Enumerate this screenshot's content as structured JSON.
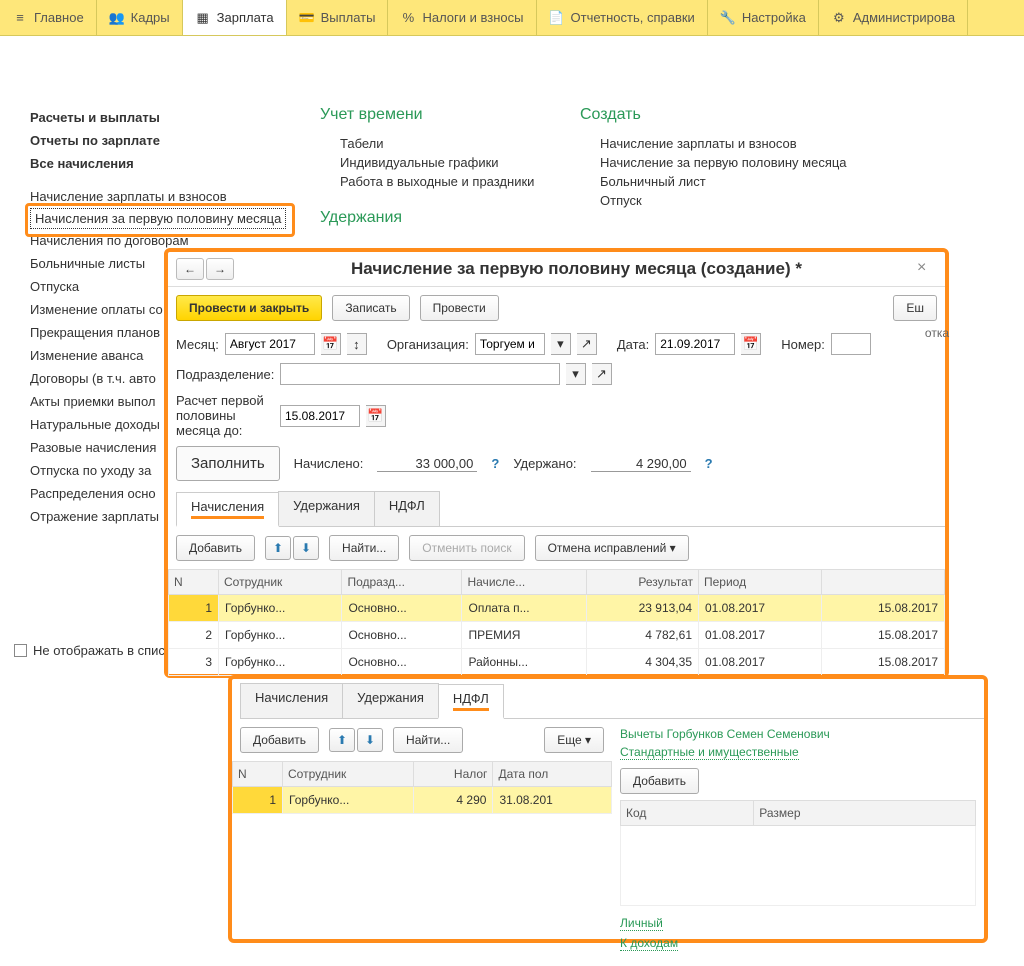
{
  "topnav": {
    "items": [
      {
        "label": "Главное"
      },
      {
        "label": "Кадры"
      },
      {
        "label": "Зарплата"
      },
      {
        "label": "Выплаты"
      },
      {
        "label": "Налоги и взносы"
      },
      {
        "label": "Отчетность, справки"
      },
      {
        "label": "Настройка"
      },
      {
        "label": "Администрирова"
      }
    ]
  },
  "nav": {
    "left_bold": [
      "Расчеты и выплаты",
      "Отчеты по зарплате",
      "Все начисления"
    ],
    "left_items": [
      "Начисление зарплаты и взносов",
      "Начисления за первую половину месяца",
      "Начисления по договорам",
      "Больничные листы",
      "Отпуска",
      "Изменение оплаты со",
      "Прекращения планов",
      "Изменение аванса",
      "Договоры (в т.ч. авто",
      "Акты приемки выпол",
      "Натуральные доходы",
      "Разовые начисления",
      "Отпуска по уходу за",
      "Распределения осно",
      "Отражение зарплаты"
    ],
    "mid_header": "Учет времени",
    "mid_items": [
      "Табели",
      "Индивидуальные графики",
      "Работа в выходные и праздники"
    ],
    "mid_header2": "Удержания",
    "right_header": "Создать",
    "right_items": [
      "Начисление зарплаты и взносов",
      "Начисление за первую половину месяца",
      "Больничный лист",
      "Отпуск"
    ]
  },
  "checkbox_label": "Не отображать в списк",
  "dialog1": {
    "title": "Начисление за первую половину месяца (создание) *",
    "btn_main": "Провести и закрыть",
    "btn_save": "Записать",
    "btn_post": "Провести",
    "btn_more": "Еш",
    "lbl_month": "Месяц:",
    "val_month": "Август 2017",
    "lbl_org": "Организация:",
    "val_org": "Торгуем и",
    "lbl_date": "Дата:",
    "val_date": "21.09.2017",
    "lbl_num": "Номер:",
    "truncated": "отка",
    "lbl_dept": "Подразделение:",
    "lbl_calc": "Расчет первой половины месяца до:",
    "val_calc": "15.08.2017",
    "btn_fill": "Заполнить",
    "lbl_accrued": "Начислено:",
    "val_accrued": "33 000,00",
    "lbl_withheld": "Удержано:",
    "val_withheld": "4 290,00",
    "tabs": [
      "Начисления",
      "Удержания",
      "НДФЛ"
    ],
    "btn_add": "Добавить",
    "btn_find": "Найти...",
    "btn_cancel_search": "Отменить поиск",
    "btn_cancel_fix": "Отмена исправлений",
    "cols": [
      "N",
      "Сотрудник",
      "Подразд...",
      "Начисле...",
      "Результат",
      "Период",
      ""
    ],
    "rows": [
      {
        "n": "1",
        "emp": "Горбунко...",
        "dept": "Основно...",
        "acc": "Оплата п...",
        "res": "23 913,04",
        "per": "01.08.2017",
        "end": "15.08.2017"
      },
      {
        "n": "2",
        "emp": "Горбунко...",
        "dept": "Основно...",
        "acc": "ПРЕМИЯ",
        "res": "4 782,61",
        "per": "01.08.2017",
        "end": "15.08.2017"
      },
      {
        "n": "3",
        "emp": "Горбунко...",
        "dept": "Основно...",
        "acc": "Районны...",
        "res": "4 304,35",
        "per": "01.08.2017",
        "end": "15.08.2017"
      }
    ]
  },
  "dialog2": {
    "tabs": [
      "Начисления",
      "Удержания",
      "НДФЛ"
    ],
    "btn_add": "Добавить",
    "btn_find": "Найти...",
    "btn_more": "Еще",
    "cols": [
      "N",
      "Сотрудник",
      "Налог",
      "Дата пол"
    ],
    "rows": [
      {
        "n": "1",
        "emp": "Горбунко...",
        "tax": "4 290",
        "date": "31.08.201"
      }
    ],
    "right_title": "Вычеты Горбунков Семен Семенович",
    "right_link": "Стандартные и имущественные",
    "btn_add2": "Добавить",
    "col_code": "Код",
    "col_size": "Размер",
    "link1": "Личный",
    "link2": "К доходам"
  }
}
